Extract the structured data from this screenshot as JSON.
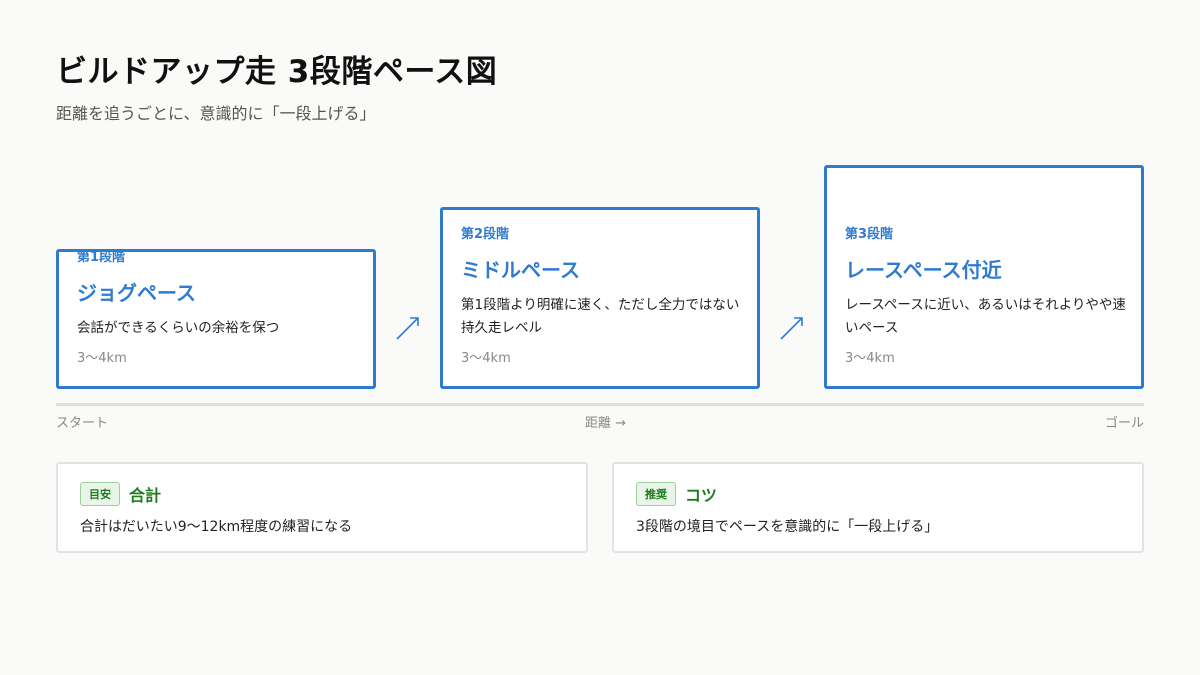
{
  "header": {
    "title": "ビルドアップ走 3段階ペース図",
    "subtitle": "距離を追うごとに、意識的に「一段上げる」"
  },
  "stages": [
    {
      "label": "第1段階",
      "name": "ジョグペース",
      "description": "会話ができるくらいの余裕を保つ",
      "range": "3〜4km"
    },
    {
      "label": "第2段階",
      "name": "ミドルペース",
      "description": "第1段階より明確に速く、ただし全力ではない持久走レベル",
      "range": "3〜4km"
    },
    {
      "label": "第3段階",
      "name": "レースペース付近",
      "description": "レースペースに近い、あるいはそれよりやや速いペース",
      "range": "3〜4km"
    }
  ],
  "axis": {
    "start": "スタート",
    "middle": "距離 →",
    "end": "ゴール"
  },
  "info": [
    {
      "badge": "目安",
      "title": "合計",
      "text": "合計はだいたい9〜12km程度の練習になる"
    },
    {
      "badge": "推奨",
      "title": "コツ",
      "text": "3段階の境目でペースを意識的に「一段上げる」"
    }
  ],
  "colors": {
    "accent": "#2f7bd0",
    "tip": "#1d7a1d",
    "axis": "#dddddd"
  },
  "icons": {
    "step": "arrow-up-right-icon"
  }
}
